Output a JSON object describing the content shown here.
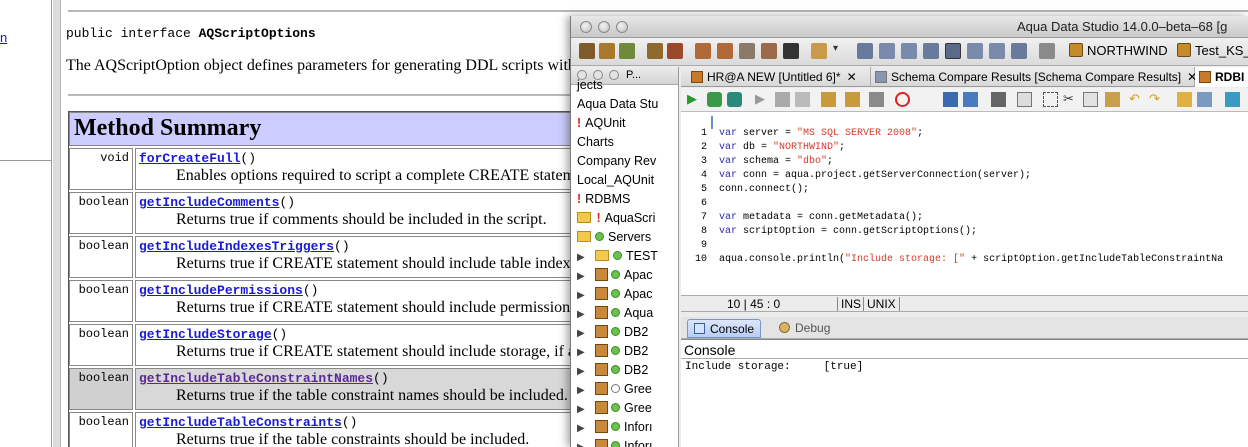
{
  "left_strip": {
    "fragment": "n"
  },
  "javadoc": {
    "interface_keyword": "public interface ",
    "interface_name": "AQScriptOptions",
    "description": "The AQScriptOption object defines parameters for generating DDL scripts withi",
    "summary_title": "Method Summary",
    "methods": [
      {
        "type": "void",
        "name": "forCreateFull",
        "parens": "()",
        "desc": "Enables options required to script a complete CREATE statemen"
      },
      {
        "type": "boolean",
        "name": "getIncludeComments",
        "parens": "()",
        "desc": "Returns true if comments should be included in the script."
      },
      {
        "type": "boolean",
        "name": "getIncludeIndexesTriggers",
        "parens": "()",
        "desc": "Returns true if CREATE statement should include table indexes"
      },
      {
        "type": "boolean",
        "name": "getIncludePermissions",
        "parens": "()",
        "desc": "Returns true if CREATE statement should include permissions."
      },
      {
        "type": "boolean",
        "name": "getIncludeStorage",
        "parens": "()",
        "desc": "Returns true if CREATE statement should include storage, if ap"
      },
      {
        "type": "boolean",
        "name": "getIncludeTableConstraintNames",
        "parens": "()",
        "desc": "Returns true if the table constraint names should be included."
      },
      {
        "type": "boolean",
        "name": "getIncludeTableConstraints",
        "parens": "()",
        "desc": "Returns true if the table constraints should be included."
      }
    ]
  },
  "ads": {
    "title": "Aqua Data Studio 14.0.0–beta–68 [g",
    "toolbar": {
      "db1": "NORTHWIND",
      "db2": "Test_KS_"
    },
    "nav": {
      "tab_label": "P...",
      "items": [
        {
          "label": "jects",
          "kind": "text"
        },
        {
          "label": "Aqua Data Stu",
          "kind": "text"
        },
        {
          "label": "AQUnit",
          "kind": "bang"
        },
        {
          "label": "Charts",
          "kind": "text"
        },
        {
          "label": "Company Rev",
          "kind": "text"
        },
        {
          "label": "Local_AQUnit",
          "kind": "text"
        },
        {
          "label": "RDBMS",
          "kind": "bang"
        },
        {
          "label": "AquaScri",
          "kind": "folder-bang"
        },
        {
          "label": "Servers",
          "kind": "folder-open"
        },
        {
          "label": "TEST",
          "kind": "server-folder"
        },
        {
          "label": "Apac",
          "kind": "server-ok"
        },
        {
          "label": "Apac",
          "kind": "server-ok"
        },
        {
          "label": "Aqua",
          "kind": "server-ok"
        },
        {
          "label": "DB2",
          "kind": "server-ok"
        },
        {
          "label": "DB2",
          "kind": "server-ok"
        },
        {
          "label": "DB2",
          "kind": "server-ok"
        },
        {
          "label": "Gree",
          "kind": "server-ko"
        },
        {
          "label": "Gree",
          "kind": "server-ok"
        },
        {
          "label": "Inforı",
          "kind": "server-ok"
        },
        {
          "label": "Inforı",
          "kind": "server-ok"
        }
      ]
    },
    "tabs": [
      {
        "label": "HR@A NEW [Untitled 6]*",
        "close": "✕"
      },
      {
        "label": "Schema Compare Results [Schema Compare Results]",
        "close": "✕"
      },
      {
        "label": "RDBI",
        "close": ""
      }
    ],
    "code_lines": [
      {
        "num": "1",
        "tokens": [
          [
            "kw",
            "var "
          ],
          [
            "",
            "server = "
          ],
          [
            "str",
            "\"MS SQL SERVER 2008\""
          ],
          [
            "",
            ";"
          ]
        ]
      },
      {
        "num": "2",
        "tokens": [
          [
            "kw",
            "var "
          ],
          [
            "",
            "db     = "
          ],
          [
            "str",
            "\"NORTHWIND\""
          ],
          [
            "",
            ";"
          ]
        ]
      },
      {
        "num": "3",
        "tokens": [
          [
            "kw",
            "var "
          ],
          [
            "",
            "schema = "
          ],
          [
            "str",
            "\"dbo\""
          ],
          [
            "",
            ";"
          ]
        ]
      },
      {
        "num": "4",
        "tokens": [
          [
            "kw",
            "var "
          ],
          [
            "",
            "conn   = aqua.project.getServerConnection(server);"
          ]
        ]
      },
      {
        "num": "5",
        "tokens": [
          [
            "",
            "conn.connect();"
          ]
        ]
      },
      {
        "num": "6",
        "tokens": []
      },
      {
        "num": "7",
        "tokens": [
          [
            "kw",
            "var "
          ],
          [
            "",
            "metadata     = conn.getMetadata();"
          ]
        ]
      },
      {
        "num": "8",
        "tokens": [
          [
            "kw",
            "var "
          ],
          [
            "",
            "scriptOption = conn.getScriptOptions();"
          ]
        ]
      },
      {
        "num": "9",
        "tokens": []
      },
      {
        "num": "10",
        "tokens": [
          [
            "",
            "aqua.console.println("
          ],
          [
            "str",
            "\"Include storage:     [\""
          ],
          [
            "",
            " + scriptOption.getIncludeTableConstraintNa"
          ]
        ]
      }
    ],
    "status": {
      "position": "10 | 45 : 0",
      "mode": "INS",
      "line_ending": "UNIX"
    },
    "console_tabs": {
      "console": "Console",
      "debug": "Debug"
    },
    "console_title": "Console",
    "console_output": "Include storage:     [true]"
  }
}
